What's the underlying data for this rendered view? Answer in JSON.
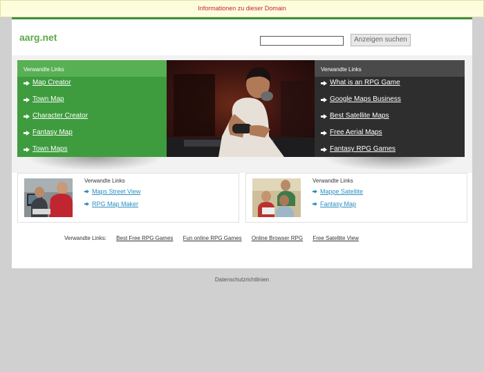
{
  "info_bar": {
    "text": "Informationen zu dieser Domain"
  },
  "header": {
    "logo": "aarg.net",
    "search_button": "Anzeigen suchen",
    "search_value": ""
  },
  "green_panel": {
    "title": "Verwandte Links",
    "links": [
      "Map Creator",
      "Town Map",
      "Character Creator",
      "Fantasy Map",
      "Town Maps"
    ]
  },
  "dark_panel": {
    "title": "Verwandte Links",
    "links": [
      "What is an RPG Game",
      "Google Maps Business",
      "Best Satellite Maps",
      "Free Aerial Maps",
      "Fantasy RPG Games"
    ]
  },
  "box_left": {
    "title": "Verwandte Links",
    "links": [
      "Maps Street View",
      "RPG Map Maker"
    ]
  },
  "box_right": {
    "title": "Verwandte Links",
    "links": [
      "Mappe Satellite",
      "Fantasy Map"
    ]
  },
  "bottom_links": {
    "label": "Verwandte Links:",
    "links": [
      "Best Free RPG Games",
      "Fun online RPG Games",
      "Online Browser RPG",
      "Free Satellite View"
    ]
  },
  "footer": {
    "text": "Datenschutzrichtlinien"
  },
  "colors": {
    "green": "#3e9c3e",
    "dark": "#2e2e2e",
    "link_blue": "#2a8ec2",
    "logo_green": "#5ba84a",
    "alert_red": "#c0262f"
  }
}
